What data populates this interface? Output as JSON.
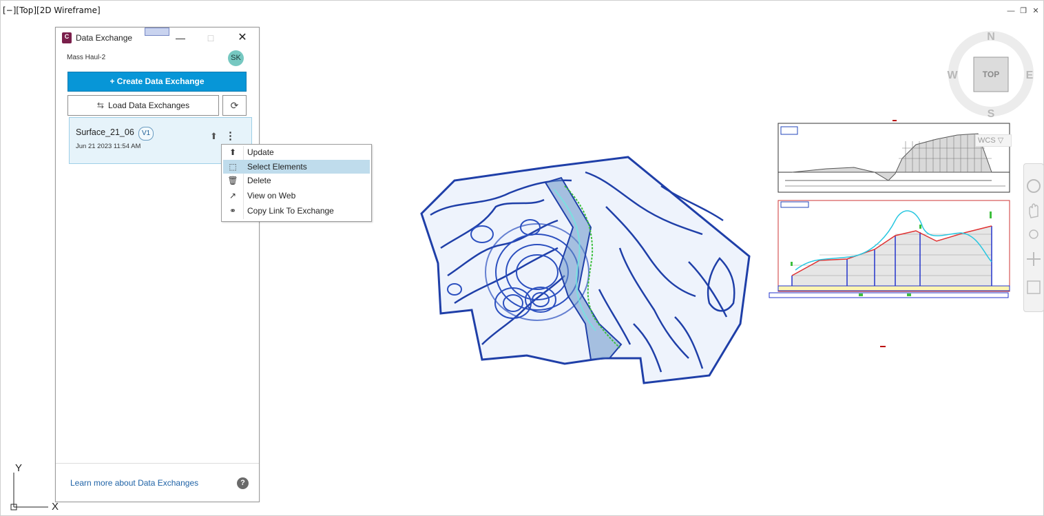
{
  "viewport": {
    "label": "[−][Top][2D Wireframe]",
    "controls": [
      "minimize-icon",
      "restore-icon",
      "close-icon"
    ]
  },
  "panel": {
    "title": "Data Exchange",
    "app_icon_letter": "C",
    "project_name": "Mass Haul-2",
    "avatar_initials": "SK",
    "create_button": "+ Create Data Exchange",
    "load_button": "Load Data Exchanges",
    "card": {
      "title": "Surface_21_06",
      "version": "V1",
      "date": "Jun 21 2023 11:54 AM"
    },
    "learn_link": "Learn more about Data Exchanges",
    "help_label": "?"
  },
  "context_menu": {
    "items": [
      {
        "label": "Update",
        "icon": "upload-icon"
      },
      {
        "label": "Select Elements",
        "icon": "select-elements-icon",
        "selected": true
      },
      {
        "label": "Delete",
        "icon": "trash-icon"
      },
      {
        "label": "View on Web",
        "icon": "external-link-icon"
      },
      {
        "label": "Copy Link To Exchange",
        "icon": "link-icon"
      }
    ]
  },
  "viewcube": {
    "north": "N",
    "south": "S",
    "east": "E",
    "west": "W",
    "face": "TOP",
    "ucs_label": "WCS"
  },
  "ucs_icon": {
    "x_label": "X",
    "y_label": "Y"
  },
  "colors": {
    "accent": "#0796d7",
    "contour": "#1f3fa8",
    "card_bg": "#e6f3fa",
    "menu_selected": "#bfdcec"
  }
}
